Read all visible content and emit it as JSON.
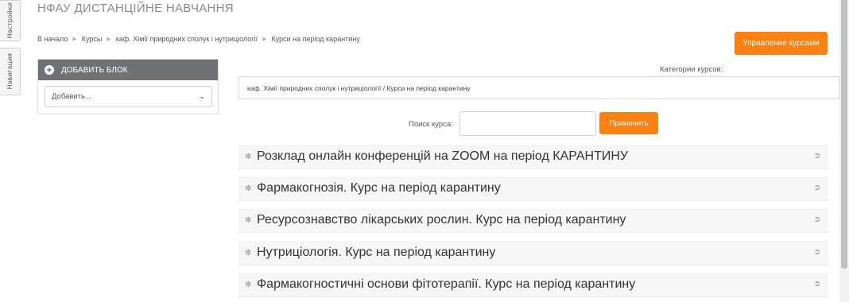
{
  "sidebar_tabs": {
    "settings": "Настройки",
    "navigation": "Навигация"
  },
  "site": {
    "title": "НФАУ ДИСТАНЦІЙНЕ НАВЧАННЯ"
  },
  "breadcrumb": {
    "items": [
      "В начало",
      "Курсы",
      "каф. Хімії природних сполук і нутриціології",
      "Курси на період карантину"
    ]
  },
  "manage_button": "Управление курсами",
  "add_block": {
    "title": "ДОБАВИТЬ БЛОК",
    "select_value": "Добавить..."
  },
  "categories": {
    "label": "Категории курсов:",
    "selected": "каф. Хімії природних сполук і нутриціології / Курси на період карантину"
  },
  "search": {
    "label": "Поиск курса:",
    "value": "",
    "button": "Применить"
  },
  "courses": [
    {
      "name": "Розклад онлайн конференцій на ZOOM на період КАРАНТИНУ"
    },
    {
      "name": "Фармакогнозія. Курс на період карантину"
    },
    {
      "name": "Ресурсознавство лікарських рослин. Курс на період карантину"
    },
    {
      "name": "Нутриціологія. Курс на період карантину"
    },
    {
      "name": "Фармакогностичні основи фітотерапії. Курс на період карантину"
    }
  ],
  "colors": {
    "accent": "#f98012",
    "block_header": "#6f7275"
  }
}
